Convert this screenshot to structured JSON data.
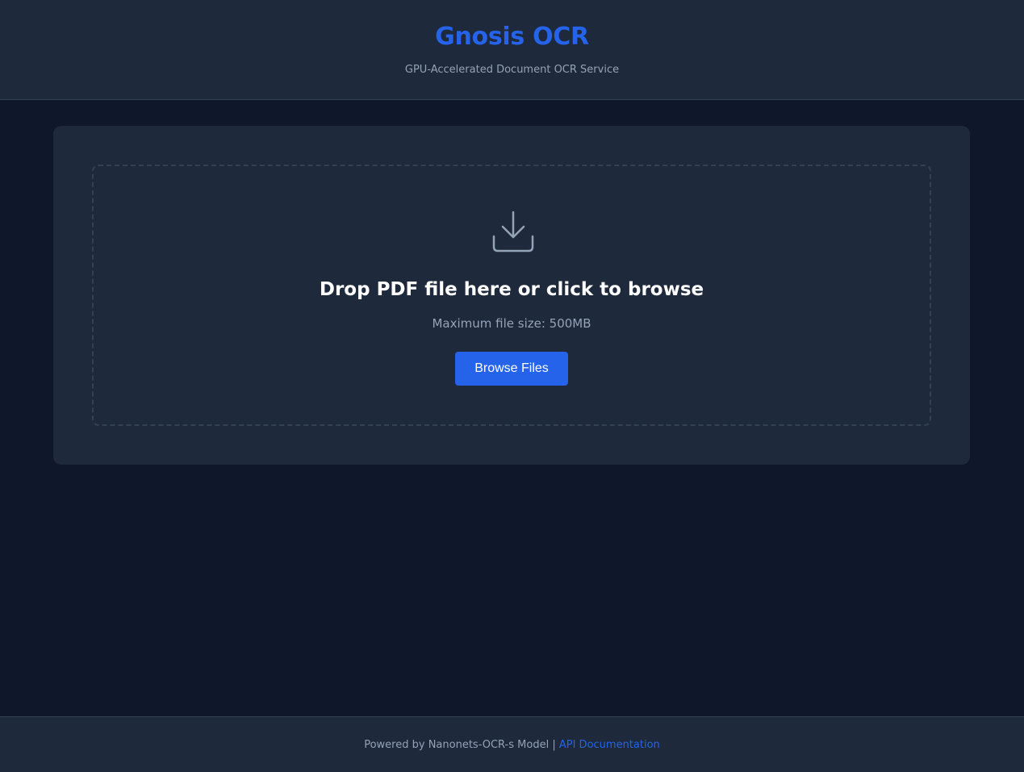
{
  "header": {
    "title": "Gnosis OCR",
    "subtitle": "GPU-Accelerated Document OCR Service"
  },
  "upload": {
    "icon": "download-tray-icon",
    "title": "Drop PDF file here or click to browse",
    "hint": "Maximum file size: 500MB",
    "button_label": "Browse Files"
  },
  "footer": {
    "powered_by": "Powered by Nanonets-OCR-s Model",
    "separator": "|",
    "api_link": "API Documentation"
  },
  "colors": {
    "accent": "#2563eb",
    "page_background": "#0f172a",
    "panel_background": "#1e293b",
    "muted_text": "#94a3b8"
  }
}
